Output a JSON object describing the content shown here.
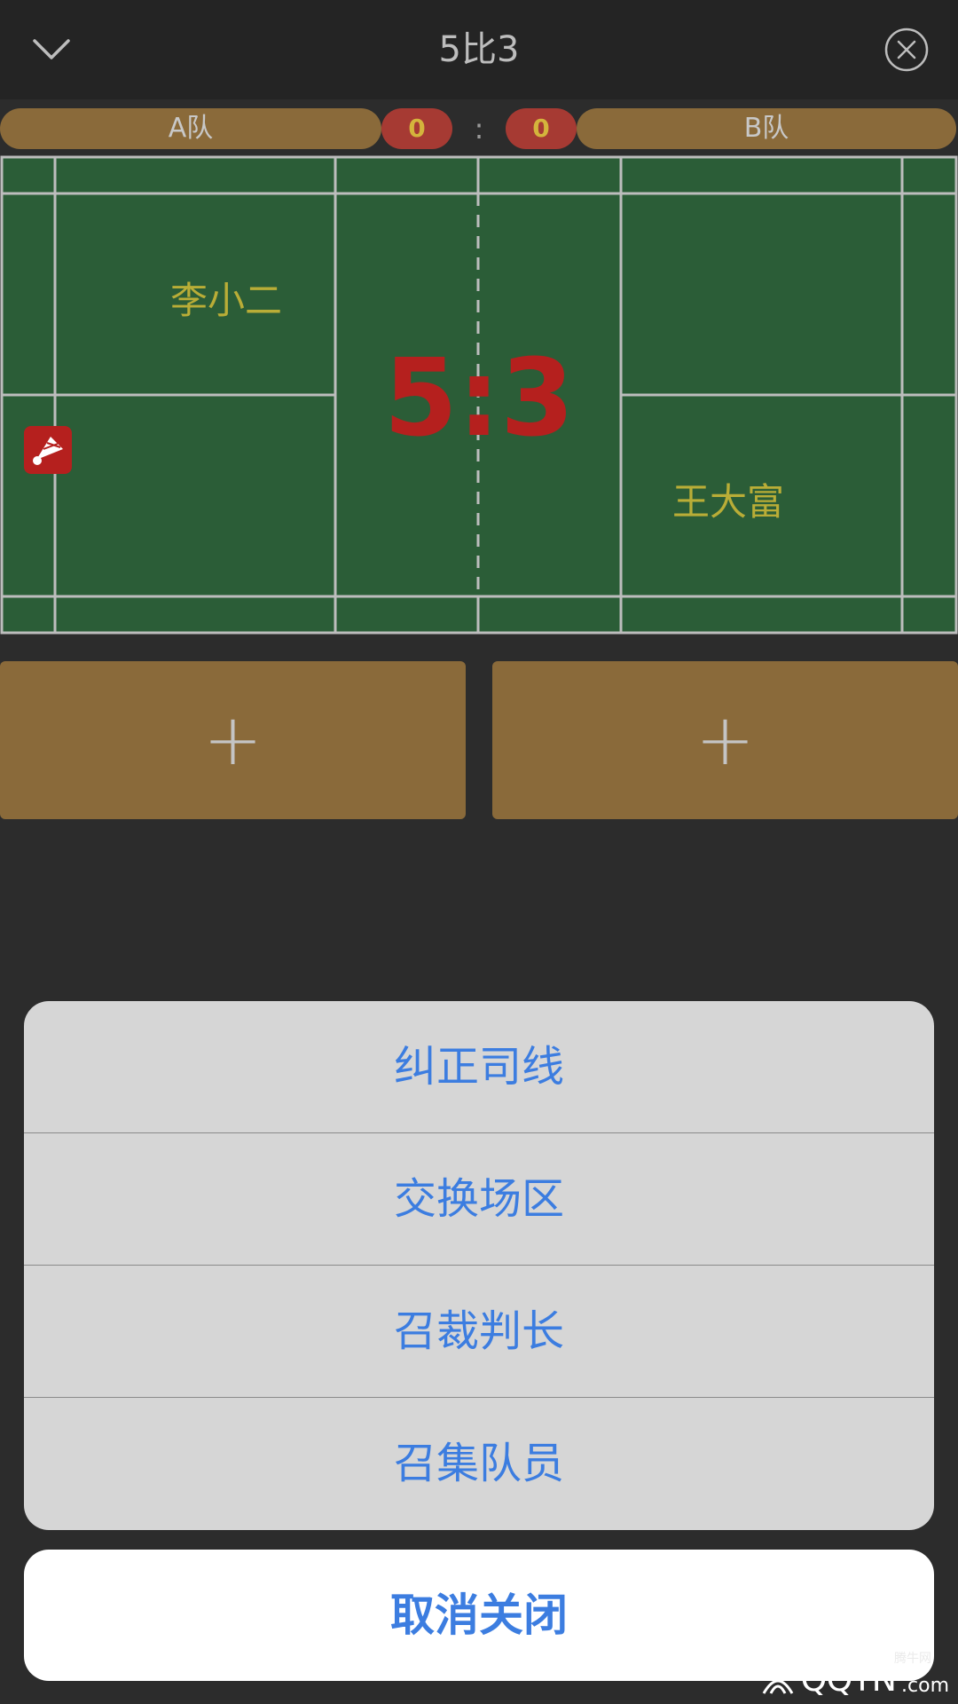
{
  "header": {
    "title": "5比3",
    "collapse_icon": "chevron-down-icon",
    "close_icon": "close-circle-icon"
  },
  "scorebar": {
    "team_a": "A队",
    "team_b": "B队",
    "games_a": "0",
    "games_b": "0",
    "separator": ":"
  },
  "court": {
    "player_a": "李小二",
    "player_b": "王大富",
    "score_a": "5",
    "score_b": "3",
    "score_separator": ":",
    "serve_icon": "shuttlecock-icon",
    "colors": {
      "court": "#2b5d37",
      "lines": "#bdbdbd",
      "score": "#b5201e",
      "player": "#b9ad37"
    }
  },
  "add_buttons": {
    "left_label": "+",
    "right_label": "+"
  },
  "action_sheet": {
    "items": [
      {
        "label": "纠正司线"
      },
      {
        "label": "交换场区"
      },
      {
        "label": "召裁判长"
      },
      {
        "label": "召集队员"
      }
    ],
    "cancel_label": "取消关闭"
  },
  "watermark": {
    "small": "腾牛网",
    "brand": "QQTN",
    "suffix": ".com"
  }
}
